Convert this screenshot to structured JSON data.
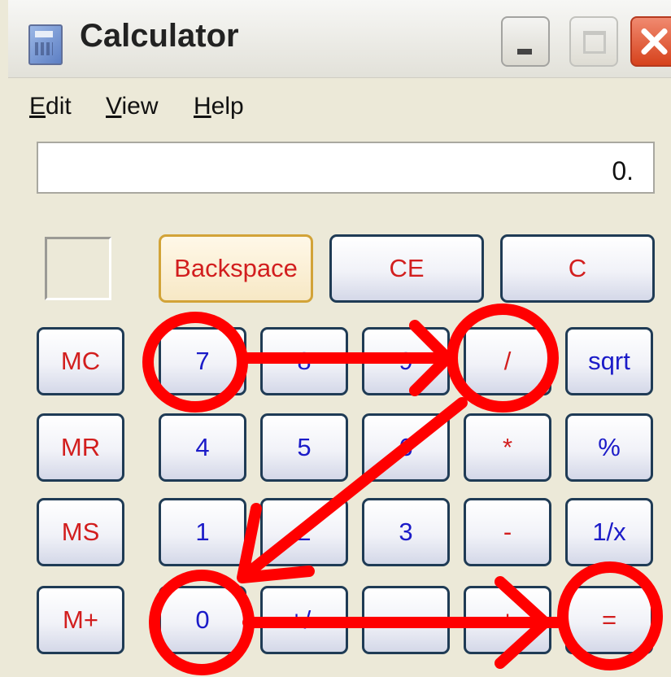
{
  "window": {
    "title": "Calculator",
    "controls": {
      "minimize": "minimize",
      "maximize": "maximize",
      "close": "close"
    }
  },
  "menu": [
    {
      "label_pre": "",
      "accel": "E",
      "label_post": "dit"
    },
    {
      "label_pre": "",
      "accel": "V",
      "label_post": "iew"
    },
    {
      "label_pre": "",
      "accel": "H",
      "label_post": "elp"
    }
  ],
  "display": {
    "value": "0."
  },
  "keys": {
    "backspace": "Backspace",
    "ce": "CE",
    "c": "C",
    "mc": "MC",
    "mr": "MR",
    "ms": "MS",
    "mplus": "M+",
    "n7": "7",
    "n8": "8",
    "n9": "9",
    "div": "/",
    "sqrt": "sqrt",
    "n4": "4",
    "n5": "5",
    "n6": "6",
    "mul": "*",
    "pct": "%",
    "n1": "1",
    "n2": "2",
    "n3": "3",
    "sub": "-",
    "inv": "1/x",
    "n0": "0",
    "sign": "+/-",
    "dot": ".",
    "add": "+",
    "eq": "="
  },
  "colors": {
    "annotation": "#ff0000",
    "digit_text": "#1b1bc8",
    "function_text": "#d21e1e",
    "window_bg": "#ece9d8"
  }
}
